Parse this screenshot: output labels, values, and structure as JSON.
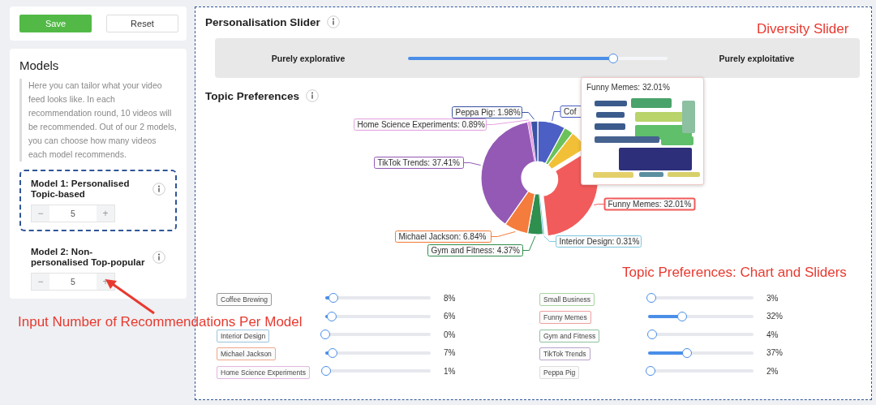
{
  "sidebar": {
    "buttons": [
      {
        "label": "Save",
        "kind": "primary"
      },
      {
        "label": "Reset",
        "kind": "secondary"
      }
    ],
    "models": {
      "title": "Models",
      "description": "Here you can tailor what your video feed looks like. In each recommendation round, 10 videos will be recommended. Out of our 2 models, you can choose how many videos each model recommends.",
      "items": [
        {
          "name": "Model 1: Personalised Topic-based",
          "value": "5",
          "decrement": "−",
          "increment": "+",
          "focused": true
        },
        {
          "name": "Model 2: Non-personalised Top-popular",
          "value": "5",
          "decrement": "−",
          "increment": "+",
          "focused": false
        }
      ]
    }
  },
  "personalisation": {
    "title": "Personalisation Slider",
    "left_label": "Purely explorative",
    "right_label": "Purely exploitative",
    "level": 0.79
  },
  "topics": {
    "title": "Topic Preferences",
    "chart_data": {
      "type": "donut",
      "values": [
        7.9,
        2.7,
        5.59,
        32.01,
        0.31,
        4.37,
        6.84,
        37.41,
        0.89,
        1.98
      ],
      "colors": [
        "#4c5fc4",
        "#6cc25a",
        "#f2c037",
        "#f25b5b",
        "#7ec8e3",
        "#2f8f4f",
        "#f47c3c",
        "#9459b5",
        "#e5a3e0",
        "#3a53a4"
      ],
      "value_labels": [
        "Cof",
        null,
        null,
        "Funny Memes: 32.01%",
        "Interior Design: 0.31%",
        "Gym and Fitness: 4.37%",
        "Michael Jackson: 6.84%",
        "TikTok Trends: 37.41%",
        "Home Science Experiments: 0.89%",
        "Peppa Pig: 1.98%"
      ]
    },
    "tooltip": {
      "title": "Funny Memes: 32.01%"
    },
    "sliders": [
      {
        "label": "Coffee Brewing",
        "color": "#9a9a9a",
        "level": 0.08,
        "reading": "8%"
      },
      {
        "level": 0.06,
        "reading": "6%"
      },
      {
        "label": "Interior Design",
        "color": "#9cc6e0",
        "level": 0.0,
        "reading": "0%"
      },
      {
        "label": "Michael Jackson",
        "color": "#f0a98a",
        "level": 0.07,
        "reading": "7%"
      },
      {
        "label": "Home Science Experiments",
        "color": "#e3b7e0",
        "level": 0.01,
        "reading": "1%"
      },
      {
        "label": "Small Business",
        "color": "#a8d5a0",
        "level": 0.03,
        "reading": "3%"
      },
      {
        "label": "Funny Memes",
        "color": "#f0a0a0",
        "level": 0.32,
        "reading": "32%"
      },
      {
        "label": "Gym and Fitness",
        "color": "#8fc4a0",
        "level": 0.04,
        "reading": "4%"
      },
      {
        "label": "TikTok Trends",
        "color": "#b9a3cc",
        "level": 0.37,
        "reading": "37%"
      },
      {
        "label": "Peppa Pig",
        "color": "#dddddd",
        "level": 0.02,
        "reading": "2%"
      }
    ]
  },
  "annotations": [
    {
      "text": "Diversity Slider",
      "kind": "plain"
    },
    {
      "text": "Topic Preferences: Chart and Sliders",
      "kind": "plain"
    },
    {
      "text": "Input Number of Recommendations Per Model",
      "kind": "arrow"
    }
  ]
}
